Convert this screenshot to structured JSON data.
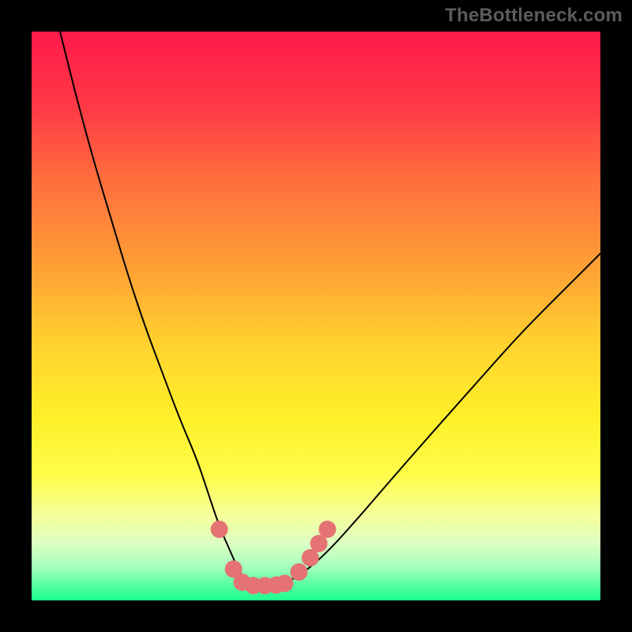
{
  "watermark": "TheBottleneck.com",
  "chart_data": {
    "type": "line",
    "title": "",
    "xlabel": "",
    "ylabel": "",
    "xlim": [
      0,
      100
    ],
    "ylim": [
      0,
      100
    ],
    "grid": false,
    "legend": false,
    "background_gradient": {
      "stops": [
        {
          "pos": 0.0,
          "color": "#ff1a4a"
        },
        {
          "pos": 0.13,
          "color": "#ff3846"
        },
        {
          "pos": 0.25,
          "color": "#ff6a3e"
        },
        {
          "pos": 0.4,
          "color": "#ff9b36"
        },
        {
          "pos": 0.55,
          "color": "#ffd22e"
        },
        {
          "pos": 0.68,
          "color": "#fff029"
        },
        {
          "pos": 0.78,
          "color": "#fffd4a"
        },
        {
          "pos": 0.85,
          "color": "#f6ff9a"
        },
        {
          "pos": 0.9,
          "color": "#dcffc2"
        },
        {
          "pos": 0.94,
          "color": "#a7ffbf"
        },
        {
          "pos": 0.97,
          "color": "#5effa2"
        },
        {
          "pos": 1.0,
          "color": "#1cff8f"
        }
      ]
    },
    "series": [
      {
        "name": "bottleneck-curve",
        "color": "#000000",
        "x": [
          5,
          8,
          11,
          14,
          17,
          20,
          23,
          26,
          29,
          31,
          33,
          35,
          36.5,
          38,
          40,
          42.5,
          45,
          48,
          52,
          57,
          63,
          70,
          78,
          86,
          94,
          100
        ],
        "y": [
          100,
          88,
          77,
          67,
          57,
          48,
          40,
          32,
          25,
          19,
          13,
          8.5,
          5,
          3.2,
          2.6,
          2.6,
          3.2,
          5,
          8.5,
          14,
          21,
          29,
          38,
          47,
          55,
          61
        ]
      }
    ],
    "markers": {
      "name": "highlight-dots",
      "color": "#e57373",
      "radius": 11,
      "points": [
        {
          "x": 33.0,
          "y": 12.5
        },
        {
          "x": 35.5,
          "y": 5.5
        },
        {
          "x": 37.0,
          "y": 3.2
        },
        {
          "x": 39.0,
          "y": 2.6
        },
        {
          "x": 41.0,
          "y": 2.6
        },
        {
          "x": 43.0,
          "y": 2.7
        },
        {
          "x": 44.5,
          "y": 3.0
        },
        {
          "x": 47.0,
          "y": 5.0
        },
        {
          "x": 49.0,
          "y": 7.5
        },
        {
          "x": 50.5,
          "y": 10.0
        },
        {
          "x": 52.0,
          "y": 12.5
        }
      ]
    }
  }
}
